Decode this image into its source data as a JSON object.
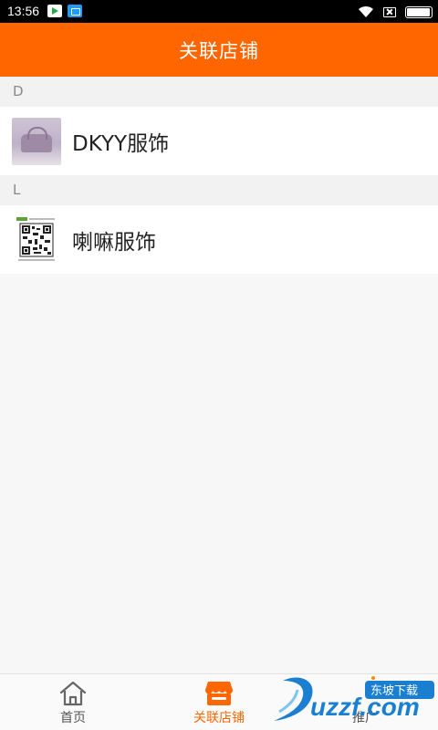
{
  "status_bar": {
    "time": "13:56",
    "battery_level": 0.95
  },
  "header": {
    "title": "关联店铺"
  },
  "sections": [
    {
      "letter": "D",
      "shops": [
        {
          "name": "DKYY服饰",
          "thumb": "handbag-photo"
        }
      ]
    },
    {
      "letter": "L",
      "shops": [
        {
          "name": "喇嘛服饰",
          "thumb": "qr-code-image"
        }
      ]
    }
  ],
  "tabs": [
    {
      "label": "首页",
      "icon": "home-icon",
      "active": false
    },
    {
      "label": "关联店铺",
      "icon": "shop-icon",
      "active": true
    },
    {
      "label": "推广",
      "icon": "promote-icon",
      "active": false
    }
  ],
  "watermark": {
    "brand": "uzzf.com",
    "tag": "东坡下载"
  },
  "colors": {
    "accent": "#ff6600",
    "header_text": "#ffffff",
    "tab_inactive": "#555555"
  }
}
